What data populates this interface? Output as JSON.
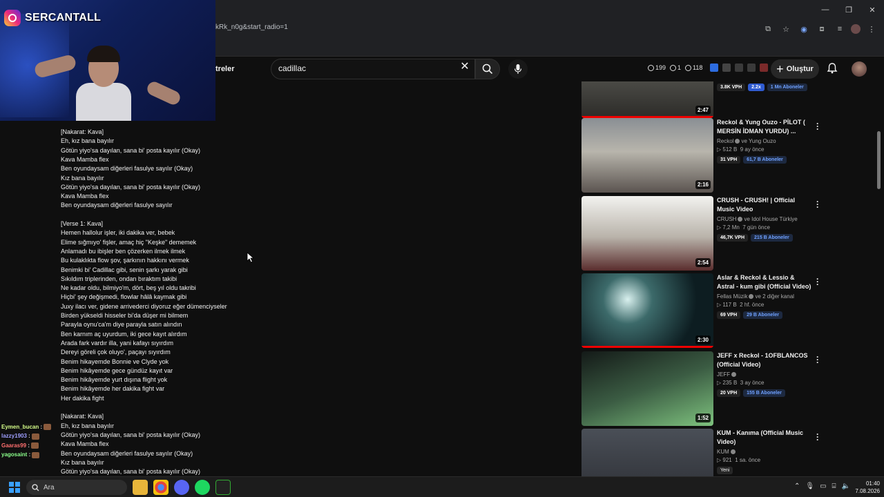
{
  "browser": {
    "url_fragment": "kRk_n0g&start_radio=1"
  },
  "youtube": {
    "filter_label": "treler",
    "search_value": "cadillac",
    "stats": {
      "a": "199",
      "b": "1",
      "c": "118"
    },
    "create_label": "Oluştur"
  },
  "streamer": {
    "name": "SERCANTALL"
  },
  "lyrics": [
    "[Nakarat: Kava]",
    "Eh, kız bana bayılır",
    "Götün yiyo'sa dayılan, sana bi' posta kayılır (Okay)",
    "Kava Mamba flex",
    "Ben oyundaysam diğerleri fasulye sayılır (Okay)",
    "Kız bana bayılır",
    "Götün yiyo'sa dayılan, sana bi' posta kayılır (Okay)",
    "Kava Mamba flex",
    "Ben oyundaysam diğerleri fasulye sayılır",
    "",
    "[Verse 1: Kava]",
    "Hemen hallolur işler, iki dakika ver, bebek",
    "Elime sığmıyo' fişler, amaç hiç \"Keşke\" dememek",
    "Anlamadı bu ibişler ben çözerken ilmek ilmek",
    "Bu kulaklıkta flow şov, şarkının hakkını vermek",
    "Benimki bi' Cadillac gibi, senin şarkı yarak gibi",
    "Sıkıldım triplerinden, ondan bıraktım takibi",
    "Ne kadar oldu, bilmiyo'm, dört, beş yıl oldu takribi",
    "Hiçbi' şey değişmedi, flowlar hâlâ kaymak gibi",
    "Juxy ilacı ver, gidene arrivederci diyoruz eğer dümenciyseler",
    "Birden yükseldi hisseler bi'da düşer mi bilmem",
    "Parayla oynu'ca'm diye parayla satın alındın",
    "Ben karnım aç uyurdum, iki gece kayıt alırdım",
    "Arada fark vardır illa, yani kafayı sıyırdım",
    "Dereyi göreli çok oluyo', paçayı sıyırdım",
    "Benim hikayemde Bonnie ve Clyde yok",
    "Benim hikâyemde gece gündüz kayıt var",
    "Benim hikâyemde yurt dışına flight yok",
    "Benim hikâyemde her dakika fight var",
    "Her dakika fight",
    "",
    "[Nakarat: Kava]",
    "Eh, kız bana bayılır",
    "Götün yiyo'sa dayılan, sana bi' posta kayılır (Okay)",
    "Kava Mamba flex",
    "Ben oyundaysam diğerleri fasulye sayılır (Okay)",
    "Kız bana bayılır",
    "Götün yiyo'sa dayılan, sana bi' posta kayılır (Okay)"
  ],
  "recommendations": [
    {
      "title": "",
      "channel": "",
      "views": "",
      "age": "",
      "vph": "3.8K VPH",
      "badge": "2.2x",
      "subs": "1 Mn Aboneler",
      "duration": "2:47",
      "new": ""
    },
    {
      "title": "Reckol & Yung Ouzo - PİLOT ( MERSİN İDMAN YURDU) ...",
      "channel": "Reckol",
      "channel2": "ve Yung Ouzo",
      "views": "512 B",
      "age": "9 ay önce",
      "vph": "31 VPH",
      "subs": "61,7 B Aboneler",
      "duration": "2:16",
      "new": ""
    },
    {
      "title": "CRUSH - CRUSH! | Official Music Video",
      "channel": "CRUSH",
      "channel2": "ve Idol House Türkiye",
      "views": "7,2 Mn",
      "age": "7 gün önce",
      "vph": "46,7K VPH",
      "subs": "215 B Aboneler",
      "duration": "2:54",
      "new": ""
    },
    {
      "title": "Aslar & Reckol & Lessio & Astral - kum gibi (Official Video)",
      "channel": "Fellas Müzik",
      "channel2": "ve 2 diğer kanal",
      "views": "117 B",
      "age": "2 hf. önce",
      "vph": "69 VPH",
      "subs": "29 B Aboneler",
      "duration": "2:30",
      "new": ""
    },
    {
      "title": "JEFF x Reckol - 1OFBLANCOS (Official Video)",
      "channel": "JEFF",
      "channel2": "",
      "views": "235 B",
      "age": "3 ay önce",
      "vph": "20 VPH",
      "subs": "155 B Aboneler",
      "duration": "1:52",
      "new": ""
    },
    {
      "title": "KUM - Kanıma (Official Music Video)",
      "channel": "KUM",
      "channel2": "",
      "views": "921",
      "age": "1 sa. önce",
      "vph": "",
      "subs": "",
      "duration": "",
      "new": "Yeni"
    }
  ],
  "chat": [
    {
      "user": "Eymen_bucan",
      "color": "#d6ff8a",
      "sep": ":"
    },
    {
      "user": "lazzy1903",
      "color": "#9f9fff",
      "sep": ":"
    },
    {
      "user": "Gaaras99",
      "color": "#ff6f6f",
      "sep": ":"
    },
    {
      "user": "yagosaint",
      "color": "#8bff8b",
      "sep": ":"
    }
  ],
  "taskbar": {
    "search_placeholder": "Ara",
    "time": "01:40",
    "date": "7.08.2026"
  }
}
